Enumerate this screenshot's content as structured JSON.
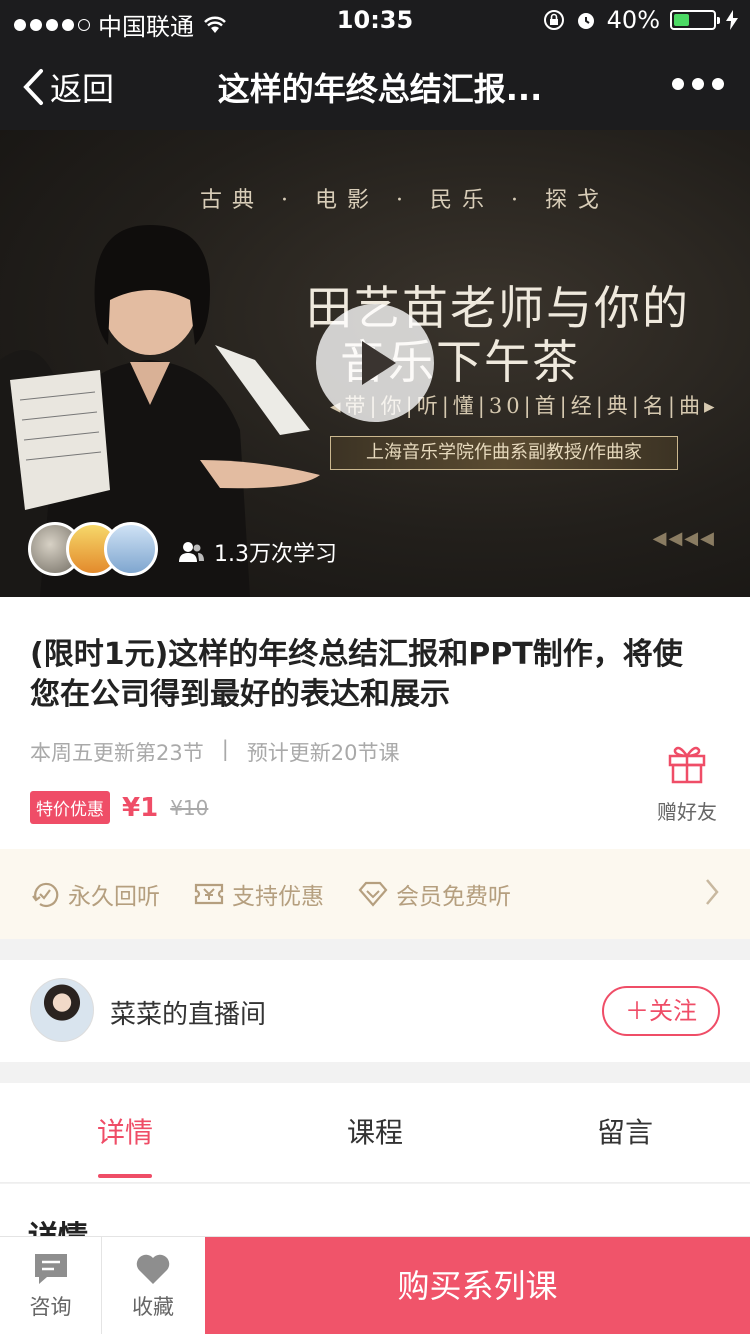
{
  "status_bar": {
    "carrier": "中国联通",
    "time": "10:35",
    "battery": "40%"
  },
  "nav": {
    "back_label": "返回",
    "title": "这样的年终总结汇报..."
  },
  "hero": {
    "tags": "古典 · 电影 · 民乐 · 探戈",
    "title_line1": "田艺苗老师与你的",
    "title_line2": "音乐下午茶",
    "subtitle": "◂带|你|听|懂|30|首|经|典|名|曲▸",
    "badge": "上海音乐学院作曲系副教授/作曲家",
    "learners": "1.3万次学习"
  },
  "course": {
    "title": "(限时1元)这样的年终总结汇报和PPT制作，将使您在公司得到最好的表达和展示",
    "update_weekly": "本周五更新第23节",
    "update_plan": "预计更新20节课",
    "promo_tag": "特价优惠",
    "price": "¥1",
    "old_price": "¥10",
    "gift_label": "赠好友"
  },
  "perks": [
    {
      "label": "永久回听",
      "icon": "replay-icon"
    },
    {
      "label": "支持优惠",
      "icon": "coupon-icon"
    },
    {
      "label": "会员免费听",
      "icon": "diamond-icon"
    }
  ],
  "host": {
    "name": "菜菜的直播间",
    "follow_label": "＋关注"
  },
  "tabs": [
    {
      "label": "详情",
      "active": true
    },
    {
      "label": "课程",
      "active": false
    },
    {
      "label": "留言",
      "active": false
    }
  ],
  "detail": {
    "heading": "详情"
  },
  "bottom_bar": {
    "consult_label": "咨询",
    "favorite_label": "收藏",
    "buy_label": "购买系列课"
  },
  "colors": {
    "accent": "#ef4d67",
    "nav_bg": "#1c1c1e",
    "perk_text": "#b59f7f",
    "perk_bg": "#fcf8ef"
  }
}
